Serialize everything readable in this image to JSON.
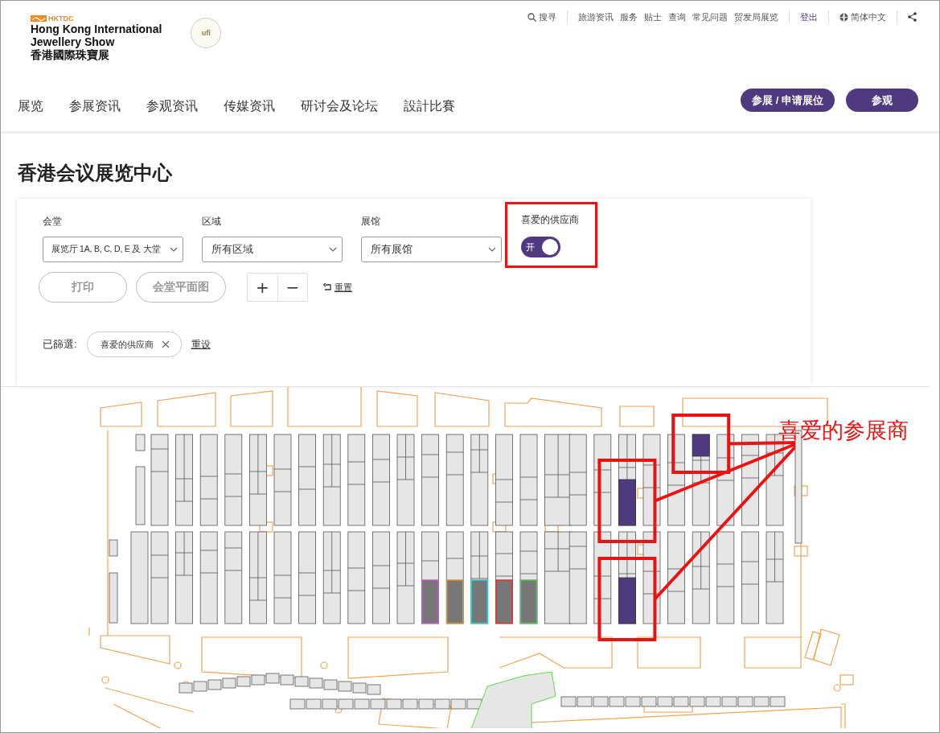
{
  "header": {
    "brand": {
      "org": "HKTDC",
      "title_lines": [
        "Hong Kong International",
        "Jewellery Show",
        "香港國際珠寶展"
      ],
      "badge": "ufi"
    },
    "utility_links": [
      {
        "label": "搜寻",
        "kind": "search"
      },
      {
        "label": "旅游资讯",
        "kind": "link"
      },
      {
        "label": "服务",
        "kind": "link"
      },
      {
        "label": "贴士",
        "kind": "link"
      },
      {
        "label": "查询",
        "kind": "link"
      },
      {
        "label": "常见问题",
        "kind": "link"
      },
      {
        "label": "贸发局展览",
        "kind": "link"
      },
      {
        "label": "登出",
        "kind": "account"
      },
      {
        "label": "简体中文",
        "kind": "language"
      },
      {
        "kind": "share"
      }
    ],
    "nav": [
      "展览",
      "参展资讯",
      "参观资讯",
      "传媒资讯",
      "研讨会及论坛",
      "設計比賽"
    ],
    "actions": [
      {
        "label": "参展 / 申请展位"
      },
      {
        "label": "参观"
      }
    ]
  },
  "page_title": "香港会议展览中心",
  "filters": {
    "selects": [
      {
        "label": "会堂",
        "value": "展览厅 1A, B, C, D, E 及 大堂"
      },
      {
        "label": "区域",
        "value": "所有区域"
      },
      {
        "label": "展馆",
        "value": "所有展馆"
      }
    ],
    "favorite_toggle": {
      "label": "喜爱的供应商",
      "on": true,
      "on_text": "开",
      "highlighted": true
    },
    "buttons": [
      {
        "label": "打印"
      },
      {
        "label": "会堂平面图"
      }
    ],
    "zoom": [
      "+",
      "−"
    ],
    "reset": "重置",
    "applied": {
      "label": "已篩選:",
      "chips": [
        {
          "label": "喜爱的供应商"
        }
      ],
      "clear": "重设"
    }
  },
  "floor_plan": {
    "annotation": {
      "label": "喜爱的参展商"
    },
    "columns": [
      {
        "top": {
          "kind": "plain"
        },
        "bottom": {
          "kind": "plain"
        }
      },
      {
        "top": {
          "kind": "plain"
        },
        "bottom": {
          "kind": "plain"
        }
      },
      {
        "top": {
          "kind": "plain"
        },
        "bottom": {
          "kind": "plain"
        }
      },
      {
        "top": {
          "kind": "plain"
        },
        "bottom": {
          "kind": "plain"
        }
      },
      {
        "top": {
          "kind": "plain"
        },
        "bottom": {
          "kind": "plain"
        }
      },
      {
        "top": {
          "kind": "plain"
        },
        "bottom": {
          "kind": "plain"
        }
      },
      {
        "top": {
          "kind": "plain"
        },
        "bottom": {
          "kind": "plain"
        }
      },
      {
        "top": {
          "kind": "plain"
        },
        "bottom": {
          "kind": "plain"
        }
      },
      {
        "top": {
          "kind": "plain"
        },
        "bottom": {
          "kind": "plain"
        }
      },
      {
        "top": {
          "kind": "plain"
        },
        "bottom": {
          "kind": "plain"
        }
      },
      {
        "top": {
          "kind": "plain"
        },
        "bottom": {
          "kind": "plain"
        }
      },
      {
        "top": {
          "kind": "plain"
        },
        "bottom": {
          "kind": "dark",
          "color": "#cc55cc"
        }
      },
      {
        "top": {
          "kind": "plain"
        },
        "bottom": {
          "kind": "dark",
          "color": "#e0902a"
        }
      },
      {
        "top": {
          "kind": "plain"
        },
        "bottom": {
          "kind": "dark",
          "color": "#33cccc"
        }
      },
      {
        "top": {
          "kind": "plain"
        },
        "bottom": {
          "kind": "dark",
          "color": "#dd3333"
        }
      },
      {
        "top": {
          "kind": "plain"
        },
        "bottom": {
          "kind": "dark",
          "color": "#44cc44"
        }
      },
      {
        "top": {
          "kind": "plain"
        },
        "bottom": {
          "kind": "plain"
        }
      },
      {
        "top": {
          "kind": "plain"
        },
        "bottom": {
          "kind": "plain"
        }
      },
      {
        "top": {
          "kind": "plain"
        },
        "bottom": {
          "kind": "plain"
        }
      },
      {
        "top": {
          "kind": "favorite_lower"
        },
        "bottom": {
          "kind": "favorite_lower"
        }
      },
      {
        "top": {
          "kind": "plain"
        },
        "bottom": {
          "kind": "plain"
        }
      },
      {
        "top": {
          "kind": "plain"
        },
        "bottom": {
          "kind": "plain"
        }
      },
      {
        "top": {
          "kind": "favorite_upper"
        },
        "bottom": {
          "kind": "plain"
        }
      },
      {
        "top": {
          "kind": "plain"
        },
        "bottom": {
          "kind": "plain"
        }
      },
      {
        "top": {
          "kind": "plain"
        },
        "bottom": {
          "kind": "plain"
        }
      },
      {
        "top": {
          "kind": "plain"
        },
        "bottom": {
          "kind": "plain"
        }
      }
    ]
  }
}
